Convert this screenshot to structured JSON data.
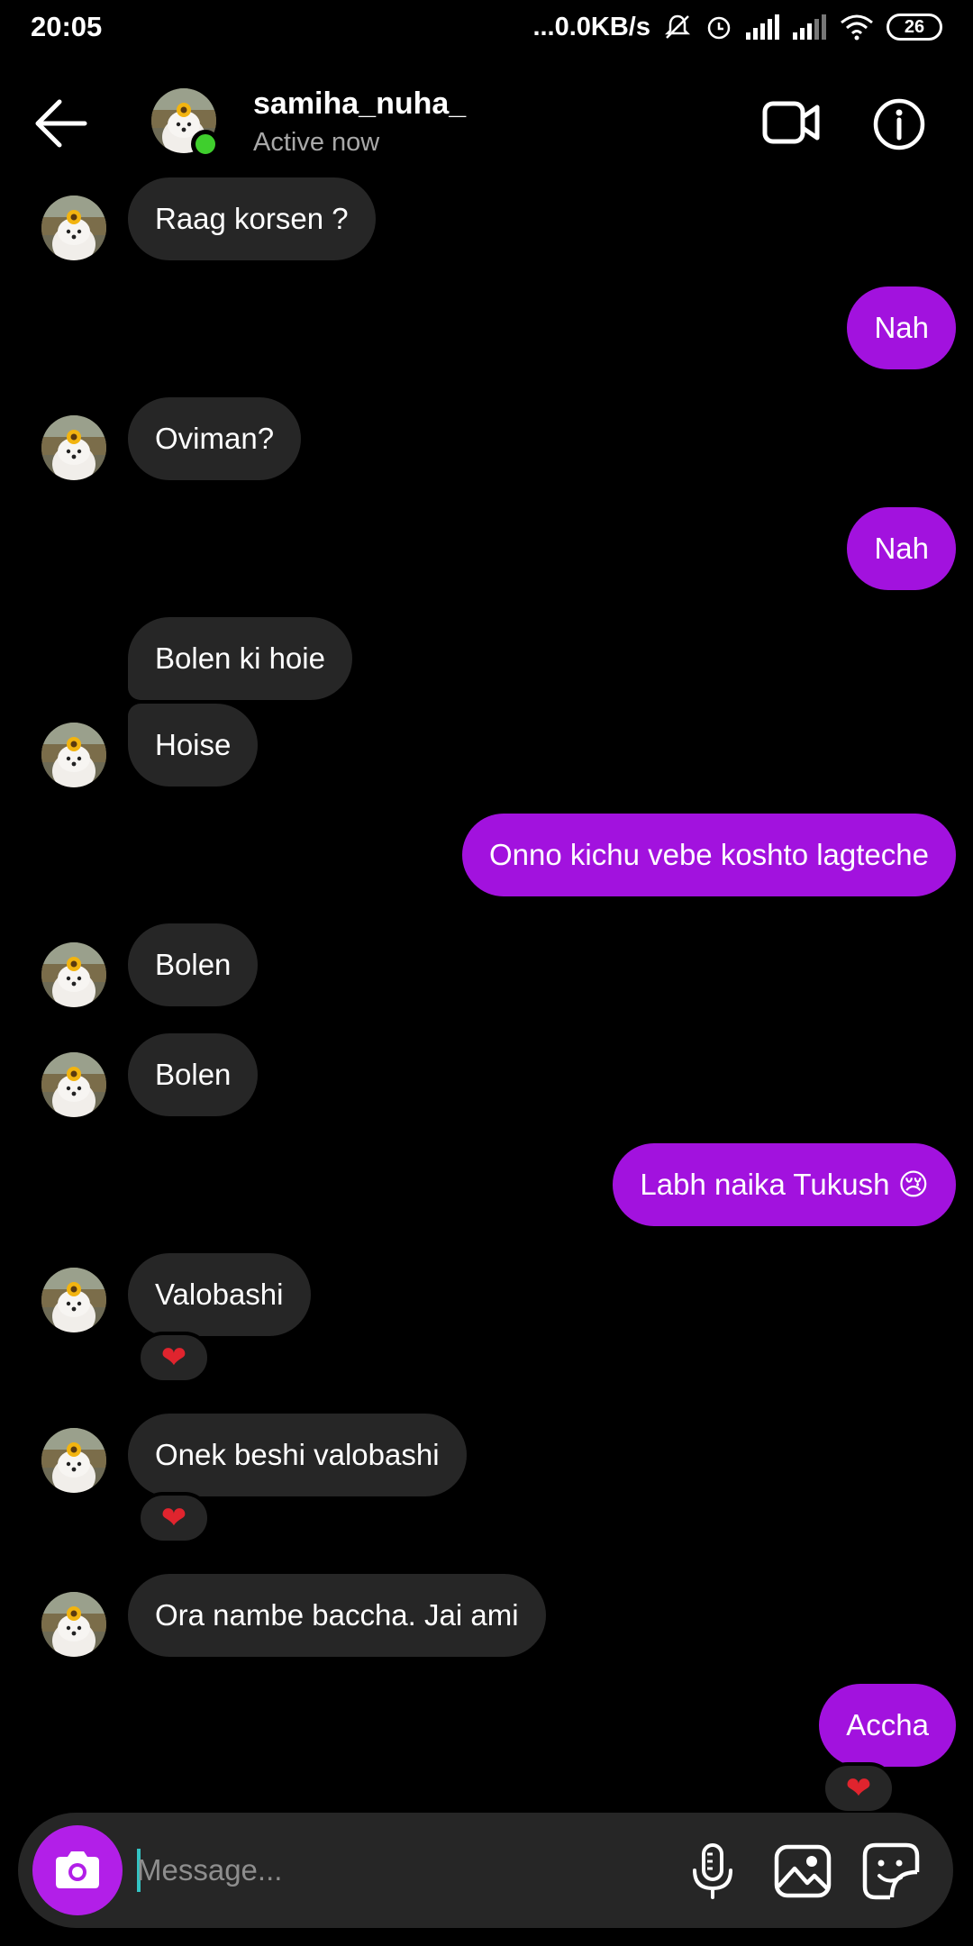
{
  "status_bar": {
    "time": "20:05",
    "network_speed": "...0.0KB/s",
    "battery": "26"
  },
  "header": {
    "username": "samiha_nuha_",
    "status": "Active now",
    "back_icon": "arrow-left-icon",
    "video_icon": "video-camera-icon",
    "info_icon": "info-icon"
  },
  "messages": [
    {
      "dir": "in",
      "text": "Raag korsen ?"
    },
    {
      "dir": "out",
      "text": "Nah"
    },
    {
      "dir": "in",
      "text": "Oviman?"
    },
    {
      "dir": "out",
      "text": "Nah"
    },
    {
      "dir": "in",
      "text": "Bolen ki hoie"
    },
    {
      "dir": "in",
      "text": "Hoise"
    },
    {
      "dir": "out",
      "text": "Onno kichu vebe koshto lagteche"
    },
    {
      "dir": "in",
      "text": "Bolen"
    },
    {
      "dir": "in",
      "text": "Bolen"
    },
    {
      "dir": "out",
      "text": "Labh naika Tukush 😢"
    },
    {
      "dir": "in",
      "text": "Valobashi",
      "reaction": "❤"
    },
    {
      "dir": "in",
      "text": "Onek beshi valobashi",
      "reaction": "❤"
    },
    {
      "dir": "in",
      "text": "Ora nambe baccha. Jai ami"
    },
    {
      "dir": "out",
      "text": "Accha",
      "reaction": "❤"
    }
  ],
  "composer": {
    "placeholder": "Message...",
    "value": "",
    "camera_icon": "camera-icon",
    "mic_icon": "microphone-icon",
    "gallery_icon": "image-icon",
    "sticker_icon": "sticker-icon"
  },
  "colors": {
    "background": "#000000",
    "incoming_bubble": "#262626",
    "outgoing_bubble": "#a212de",
    "online_indicator": "#3fcf2d",
    "camera_button": "#b21fe8",
    "reaction_heart": "#e0242e"
  }
}
